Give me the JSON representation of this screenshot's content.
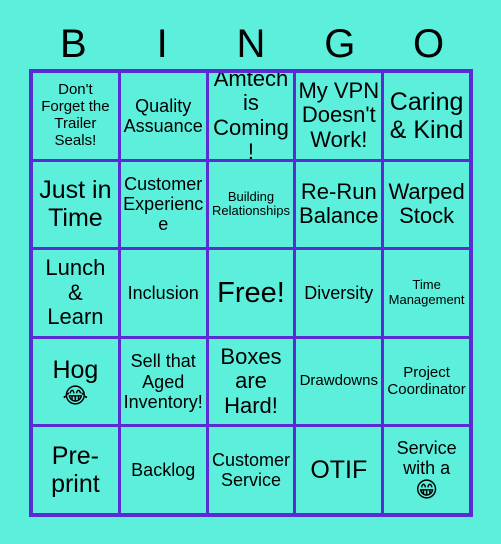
{
  "card": {
    "background_color": "#5BEFDC",
    "grid_border_color": "#5B2BD4",
    "text_color": "#000000"
  },
  "header": {
    "letters": [
      "B",
      "I",
      "N",
      "G",
      "O"
    ]
  },
  "grid": {
    "rows": [
      [
        {
          "text": "Don't\nForget the\nTrailer\nSeals!",
          "size": "fs-sm",
          "emoji": ""
        },
        {
          "text": "Quality\nAssuance",
          "size": "fs-md",
          "emoji": ""
        },
        {
          "text": "Amtech\nis\nComing!",
          "size": "fs-lg",
          "emoji": ""
        },
        {
          "text": "My VPN\nDoesn't\nWork!",
          "size": "fs-lg",
          "emoji": ""
        },
        {
          "text": "Caring\n& Kind",
          "size": "fs-xl",
          "emoji": ""
        }
      ],
      [
        {
          "text": "Just in\nTime",
          "size": "fs-xl",
          "emoji": ""
        },
        {
          "text": "Customer\nExperience",
          "size": "fs-md",
          "emoji": ""
        },
        {
          "text": "Building\nRelationships",
          "size": "fs-xs",
          "emoji": ""
        },
        {
          "text": "Re-Run\nBalance",
          "size": "fs-lg",
          "emoji": ""
        },
        {
          "text": "Warped\nStock",
          "size": "fs-lg",
          "emoji": ""
        }
      ],
      [
        {
          "text": "Lunch\n&\nLearn",
          "size": "fs-lg",
          "emoji": ""
        },
        {
          "text": "Inclusion",
          "size": "fs-md",
          "emoji": ""
        },
        {
          "text": "Free!",
          "size": "fs-free",
          "emoji": ""
        },
        {
          "text": "Diversity",
          "size": "fs-md",
          "emoji": ""
        },
        {
          "text": "Time\nManagement",
          "size": "fs-xs",
          "emoji": ""
        }
      ],
      [
        {
          "text": "Hog",
          "size": "fs-xl",
          "emoji": "😂"
        },
        {
          "text": "Sell that\nAged\nInventory!",
          "size": "fs-md",
          "emoji": ""
        },
        {
          "text": "Boxes\nare\nHard!",
          "size": "fs-lg",
          "emoji": ""
        },
        {
          "text": "Drawdowns",
          "size": "fs-sm",
          "emoji": ""
        },
        {
          "text": "Project\nCoordinator",
          "size": "fs-sm",
          "emoji": ""
        }
      ],
      [
        {
          "text": "Pre-\nprint",
          "size": "fs-xl",
          "emoji": ""
        },
        {
          "text": "Backlog",
          "size": "fs-md",
          "emoji": ""
        },
        {
          "text": "Customer\nService",
          "size": "fs-md",
          "emoji": ""
        },
        {
          "text": "OTIF",
          "size": "fs-xl",
          "emoji": ""
        },
        {
          "text": "Service\nwith a",
          "size": "fs-md",
          "emoji": "😁"
        }
      ]
    ]
  }
}
